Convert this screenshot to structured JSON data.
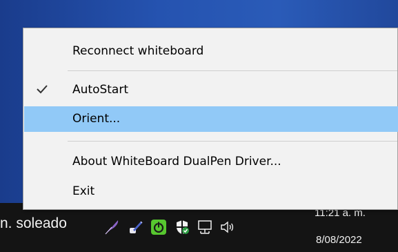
{
  "menu": {
    "items": [
      {
        "label": "Reconnect whiteboard",
        "checked": false,
        "highlighted": false
      },
      {
        "label": "AutoStart",
        "checked": true,
        "highlighted": false
      },
      {
        "label": "Orient...",
        "checked": false,
        "highlighted": true
      },
      {
        "label": "About WhiteBoard DualPen Driver...",
        "checked": false,
        "highlighted": false
      },
      {
        "label": "Exit",
        "checked": false,
        "highlighted": false
      }
    ]
  },
  "taskbar": {
    "weather_text": "n. soleado",
    "time": "11:21 a. m.",
    "date": "8/08/2022",
    "tray_icons": [
      "pen-icon",
      "pen-tool-icon",
      "power-icon",
      "shield-icon",
      "network-icon",
      "speaker-icon"
    ]
  },
  "colors": {
    "menu_background": "#f2f2f2",
    "highlight": "#91c9f7",
    "taskbar": "#141414",
    "power_icon": "#57c72f"
  }
}
